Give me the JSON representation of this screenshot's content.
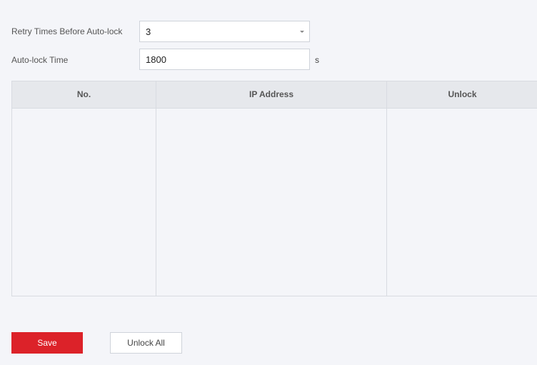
{
  "form": {
    "retry": {
      "label": "Retry Times Before Auto-lock",
      "value": "3",
      "icon": "chevron-down-icon"
    },
    "autolock": {
      "label": "Auto-lock Time",
      "value": "1800",
      "unit": "s"
    }
  },
  "table": {
    "columns": [
      "No.",
      "IP Address",
      "Unlock"
    ],
    "rows": []
  },
  "actions": {
    "save_label": "Save",
    "unlock_all_label": "Unlock All"
  },
  "colors": {
    "accent": "#dc2229",
    "background": "#f4f5f9",
    "header": "#e6e8ec"
  }
}
